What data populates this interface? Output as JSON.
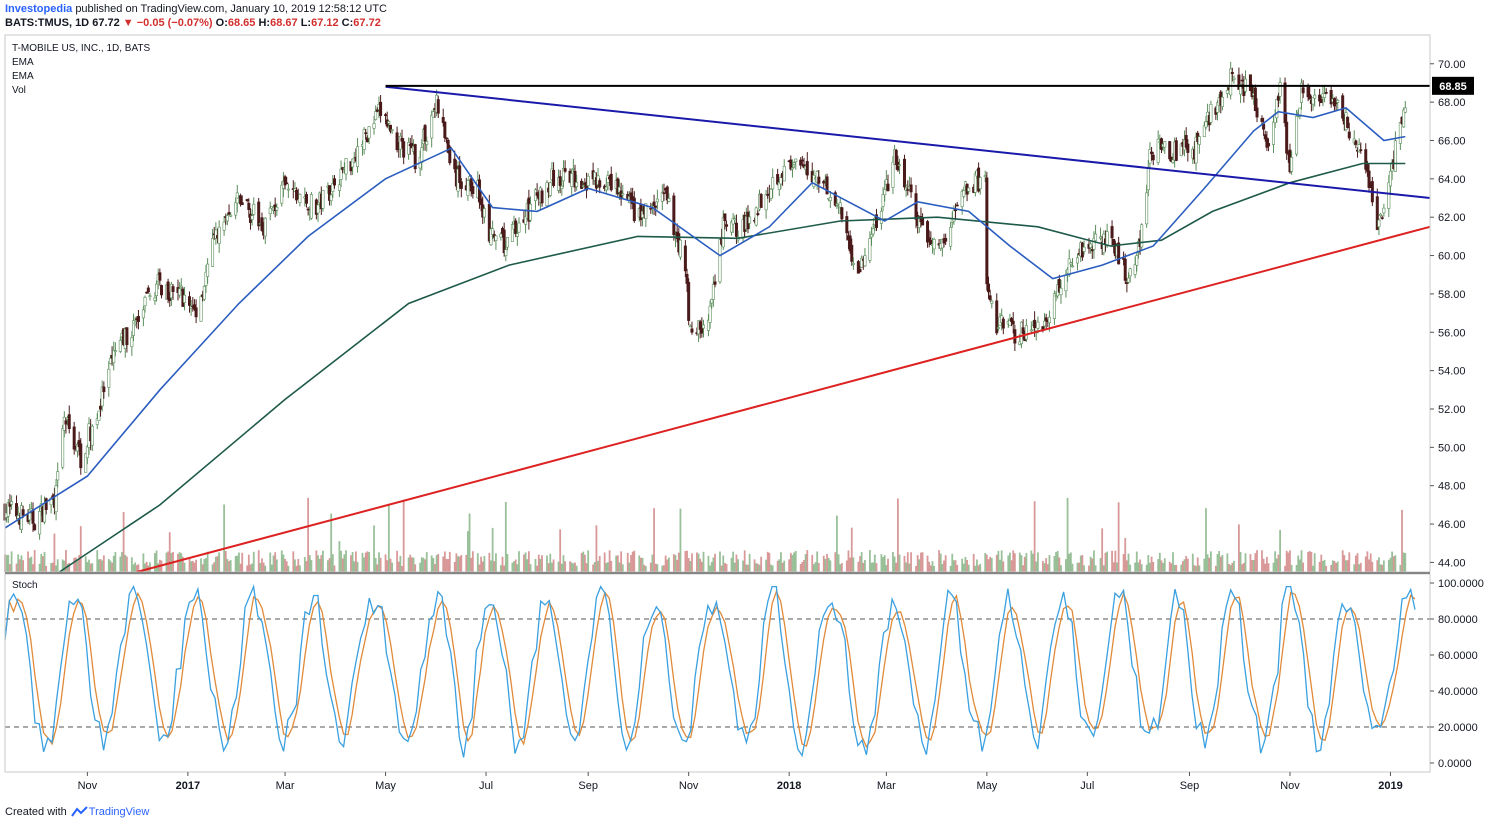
{
  "header": {
    "publisher": "Investopedia",
    "published_text": "published on TradingView.com, January 10, 2019 12:58:12 UTC",
    "symbol": "BATS:TMUS, 1D",
    "last": "67.72",
    "change": "−0.05 (−0.07%)",
    "o_label": "O:",
    "o_val": "68.65",
    "h_label": "H:",
    "h_val": "68.67",
    "l_label": "L:",
    "l_val": "67.12",
    "c_label": "C:",
    "c_val": "67.72"
  },
  "legend": {
    "title": "T-MOBILE US, INC., 1D, BATS",
    "ema1": "EMA",
    "ema2": "EMA",
    "vol": "Vol",
    "stoch": "Stoch"
  },
  "footer": {
    "created_with": "Created with",
    "brand": "TradingView"
  },
  "colors": {
    "up": "#5a8e5a",
    "down": "#4a1a1a",
    "ema_fast": "#2a5dbf",
    "ema_slow": "#1e5a4a",
    "blue_line": "#1a1aaa",
    "red_line": "#dd2222",
    "horizontal": "#000000",
    "stoch_k": "#3aa0e0",
    "stoch_d": "#e08a3a"
  },
  "chart_data": [
    {
      "type": "candlestick",
      "title": "T-MOBILE US, INC., 1D, BATS",
      "price_axis": [
        "70.00",
        "68.00",
        "66.00",
        "64.00",
        "62.00",
        "60.00",
        "58.00",
        "56.00",
        "54.00",
        "52.00",
        "50.00",
        "48.00",
        "46.00",
        "44.00"
      ],
      "ylim": [
        43.5,
        71.5
      ],
      "x_ticks": [
        "Nov",
        "2017",
        "Mar",
        "May",
        "Jul",
        "Sep",
        "Nov",
        "2018",
        "Mar",
        "May",
        "Jul",
        "Sep",
        "Nov",
        "2019"
      ],
      "x_range": [
        "2016-09-12",
        "2019-01-25"
      ],
      "last_price_marker": "68.85",
      "close_path": [
        [
          "2016-09-12",
          46.8
        ],
        [
          "2016-09-30",
          46.2
        ],
        [
          "2016-10-13",
          47.5
        ],
        [
          "2016-10-18",
          51.5
        ],
        [
          "2016-10-28",
          49.5
        ],
        [
          "2016-11-08",
          52
        ],
        [
          "2016-11-18",
          55
        ],
        [
          "2016-12-01",
          56.5
        ],
        [
          "2016-12-13",
          58.5
        ],
        [
          "2016-12-28",
          58
        ],
        [
          "2017-01-06",
          57
        ],
        [
          "2017-01-18",
          61
        ],
        [
          "2017-02-02",
          63
        ],
        [
          "2017-02-15",
          61.5
        ],
        [
          "2017-03-01",
          63.5
        ],
        [
          "2017-03-20",
          62.5
        ],
        [
          "2017-04-10",
          65
        ],
        [
          "2017-04-28",
          67.5
        ],
        [
          "2017-05-08",
          66
        ],
        [
          "2017-05-20",
          65
        ],
        [
          "2017-06-01",
          68
        ],
        [
          "2017-06-12",
          64
        ],
        [
          "2017-06-26",
          63.5
        ],
        [
          "2017-07-03",
          61
        ],
        [
          "2017-07-12",
          60.5
        ],
        [
          "2017-07-28",
          62.5
        ],
        [
          "2017-08-10",
          64
        ],
        [
          "2017-08-28",
          64
        ],
        [
          "2017-09-18",
          63.5
        ],
        [
          "2017-10-02",
          62
        ],
        [
          "2017-10-18",
          63
        ],
        [
          "2017-10-30",
          59.5
        ],
        [
          "2017-11-02",
          56
        ],
        [
          "2017-11-13",
          56.5
        ],
        [
          "2017-11-16",
          58
        ],
        [
          "2017-11-22",
          61.5
        ],
        [
          "2017-12-06",
          61.5
        ],
        [
          "2017-12-18",
          63.5
        ],
        [
          "2017-12-28",
          64.5
        ],
        [
          "2018-01-08",
          64.5
        ],
        [
          "2018-01-22",
          64
        ],
        [
          "2018-02-02",
          62
        ],
        [
          "2018-02-12",
          59
        ],
        [
          "2018-02-22",
          61.5
        ],
        [
          "2018-03-06",
          65
        ],
        [
          "2018-03-16",
          63
        ],
        [
          "2018-03-23",
          61
        ],
        [
          "2018-04-05",
          60.5
        ],
        [
          "2018-04-16",
          63.5
        ],
        [
          "2018-04-30",
          64
        ],
        [
          "2018-05-01",
          58
        ],
        [
          "2018-05-07",
          56.5
        ],
        [
          "2018-05-18",
          56
        ],
        [
          "2018-05-29",
          56
        ],
        [
          "2018-06-08",
          57
        ],
        [
          "2018-06-18",
          59.5
        ],
        [
          "2018-06-29",
          60.5
        ],
        [
          "2018-07-12",
          61
        ],
        [
          "2018-07-25",
          59
        ],
        [
          "2018-08-02",
          60.5
        ],
        [
          "2018-08-08",
          65.5
        ],
        [
          "2018-08-20",
          65.5
        ],
        [
          "2018-09-04",
          65.5
        ],
        [
          "2018-09-14",
          67.5
        ],
        [
          "2018-09-28",
          69.5
        ],
        [
          "2018-10-10",
          68
        ],
        [
          "2018-10-18",
          66
        ],
        [
          "2018-10-26",
          68.5
        ],
        [
          "2018-11-01",
          64.5
        ],
        [
          "2018-11-08",
          68.5
        ],
        [
          "2018-11-20",
          68
        ],
        [
          "2018-12-03",
          67.5
        ],
        [
          "2018-12-12",
          65.5
        ],
        [
          "2018-12-20",
          63.5
        ],
        [
          "2018-12-24",
          61.5
        ],
        [
          "2018-12-31",
          63.5
        ],
        [
          "2019-01-07",
          67
        ],
        [
          "2019-01-10",
          67.72
        ]
      ],
      "ema_fast_path": [
        [
          "2016-09-12",
          45.8
        ],
        [
          "2016-11-01",
          48.5
        ],
        [
          "2016-12-15",
          53
        ],
        [
          "2017-02-01",
          57.5
        ],
        [
          "2017-03-15",
          61
        ],
        [
          "2017-05-01",
          64
        ],
        [
          "2017-06-10",
          65.6
        ],
        [
          "2017-07-05",
          62.5
        ],
        [
          "2017-08-01",
          62.3
        ],
        [
          "2017-09-01",
          63.5
        ],
        [
          "2017-10-10",
          62.5
        ],
        [
          "2017-11-20",
          60
        ],
        [
          "2017-12-20",
          61.5
        ],
        [
          "2018-01-15",
          63.8
        ],
        [
          "2018-02-28",
          61.8
        ],
        [
          "2018-03-20",
          62.8
        ],
        [
          "2018-04-20",
          62.3
        ],
        [
          "2018-05-15",
          60.5
        ],
        [
          "2018-06-10",
          58.8
        ],
        [
          "2018-07-10",
          59.5
        ],
        [
          "2018-08-10",
          60.5
        ],
        [
          "2018-09-10",
          63.5
        ],
        [
          "2018-10-10",
          66.5
        ],
        [
          "2018-10-25",
          67.5
        ],
        [
          "2018-11-15",
          67.2
        ],
        [
          "2018-12-05",
          67.7
        ],
        [
          "2018-12-28",
          66
        ],
        [
          "2019-01-10",
          66.2
        ]
      ],
      "ema_slow_path": [
        [
          "2016-10-15",
          43.5
        ],
        [
          "2016-12-15",
          47
        ],
        [
          "2017-03-01",
          52.5
        ],
        [
          "2017-05-15",
          57.5
        ],
        [
          "2017-07-15",
          59.5
        ],
        [
          "2017-10-01",
          61
        ],
        [
          "2017-12-01",
          60.9
        ],
        [
          "2018-02-01",
          61.8
        ],
        [
          "2018-04-01",
          62
        ],
        [
          "2018-06-01",
          61.5
        ],
        [
          "2018-07-15",
          60.5
        ],
        [
          "2018-08-15",
          60.8
        ],
        [
          "2018-09-15",
          62.3
        ],
        [
          "2018-11-01",
          63.8
        ],
        [
          "2018-12-15",
          64.8
        ],
        [
          "2019-01-10",
          64.8
        ]
      ],
      "trendlines": [
        {
          "name": "resistance",
          "from": [
            "2017-05-01",
            68.8
          ],
          "to": [
            "2019-01-25",
            63.0
          ]
        },
        {
          "name": "support",
          "from": [
            "2016-12-01",
            43.5
          ],
          "to": [
            "2019-01-25",
            61.5
          ]
        },
        {
          "name": "horizontal",
          "from": [
            "2017-05-01",
            68.85
          ],
          "to": [
            "2019-01-25",
            68.85
          ]
        }
      ]
    },
    {
      "type": "line",
      "title": "Stoch",
      "y_axis": [
        "100.0000",
        "80.0000",
        "60.0000",
        "40.0000",
        "20.0000",
        "0.0000"
      ],
      "ylim": [
        -5,
        105
      ],
      "levels": [
        80,
        20
      ],
      "series": [
        {
          "color": "#3aa0e0"
        },
        {
          "color": "#e08a3a"
        }
      ]
    }
  ]
}
